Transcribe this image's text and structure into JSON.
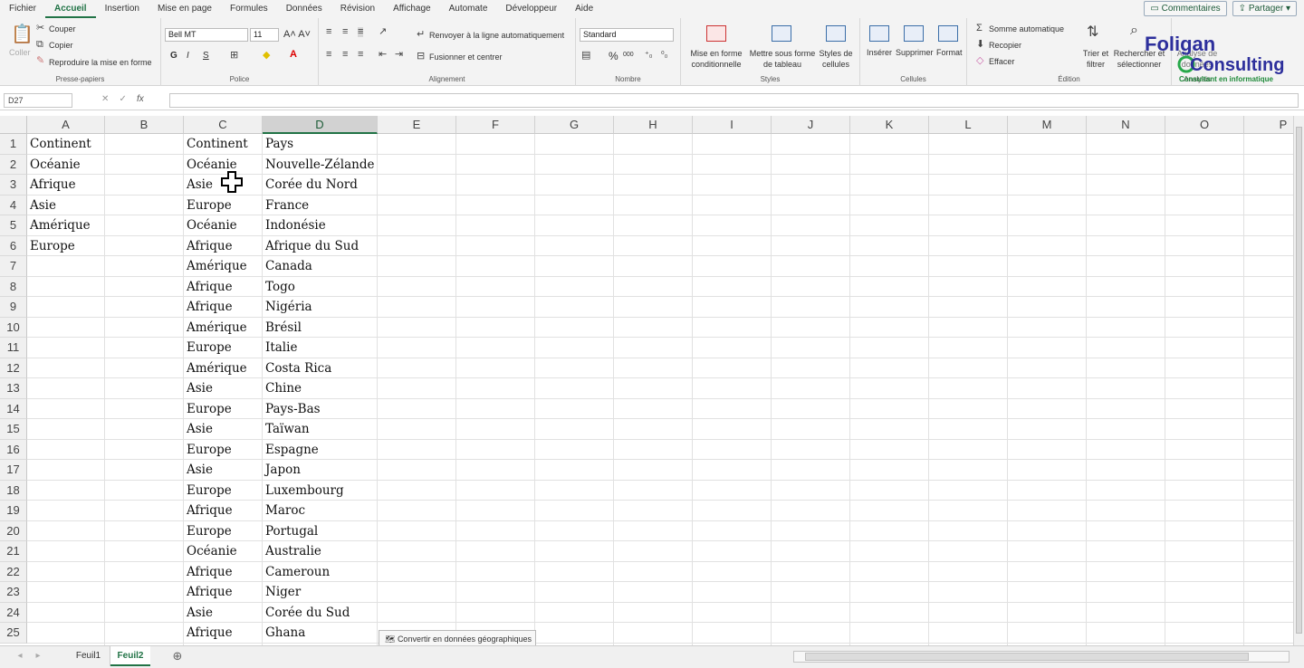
{
  "menu": {
    "tabs": [
      "Fichier",
      "Accueil",
      "Insertion",
      "Mise en page",
      "Formules",
      "Données",
      "Révision",
      "Affichage",
      "Automate",
      "Développeur",
      "Aide"
    ],
    "active": "Accueil",
    "comments_label": "Commentaires",
    "share_label": "Partager"
  },
  "ribbon": {
    "clipboard": {
      "paste": "Coller",
      "cut": "Couper",
      "copy": "Copier",
      "format_painter": "Reproduire la mise en forme",
      "title": "Presse-papiers"
    },
    "font": {
      "name": "Bell MT",
      "size": "11",
      "bold": "G",
      "italic": "I",
      "underline": "S",
      "title": "Police"
    },
    "alignment": {
      "wrap": "Renvoyer à la ligne automatiquement",
      "merge": "Fusionner et centrer",
      "title": "Alignement"
    },
    "number": {
      "format": "Standard",
      "percent": "%",
      "thousands": "000",
      "title": "Nombre"
    },
    "styles": {
      "conditional": "Mise en forme conditionnelle",
      "table": "Mettre sous forme de tableau",
      "cell_styles": "Styles de cellules",
      "title": "Styles"
    },
    "cells": {
      "insert": "Insérer",
      "delete": "Supprimer",
      "format": "Format",
      "title": "Cellules"
    },
    "editing": {
      "autosum": "Somme automatique",
      "fill": "Recopier",
      "clear": "Effacer",
      "sort": "Trier et filtrer",
      "find": "Rechercher et sélectionner",
      "title": "Édition"
    },
    "analysis": {
      "analyze": "Analyse de données",
      "title": "Analysis"
    }
  },
  "logo": {
    "line1": "Foligan",
    "line2": "Consulting",
    "tagline": "Consultant en informatique"
  },
  "formula_bar": {
    "name_box": "D27",
    "fx": "fx",
    "value": ""
  },
  "columns": [
    "A",
    "B",
    "C",
    "D",
    "E",
    "F",
    "G",
    "H",
    "I",
    "J",
    "K",
    "L",
    "M",
    "N",
    "O",
    "P"
  ],
  "selected_column": "D",
  "rows": [
    "1",
    "2",
    "3",
    "4",
    "5",
    "6",
    "7",
    "8",
    "9",
    "10",
    "11",
    "12",
    "13",
    "14",
    "15",
    "16",
    "17",
    "18",
    "19",
    "20",
    "21",
    "22",
    "23",
    "24",
    "25"
  ],
  "col_a": [
    "Continent",
    "Océanie",
    "Afrique",
    "Asie",
    "Amérique",
    "Europe"
  ],
  "col_c": [
    "Continent",
    "Océanie",
    "Asie",
    "Europe",
    "Océanie",
    "Afrique",
    "Amérique",
    "Afrique",
    "Afrique",
    "Amérique",
    "Europe",
    "Amérique",
    "Asie",
    "Europe",
    "Asie",
    "Europe",
    "Asie",
    "Europe",
    "Afrique",
    "Europe",
    "Océanie",
    "Afrique",
    "Afrique",
    "Asie",
    "Afrique"
  ],
  "col_d": [
    "Pays",
    "Nouvelle-Zélande",
    "Corée du Nord",
    "France",
    "Indonésie",
    "Afrique du Sud",
    "Canada",
    "Togo",
    "Nigéria",
    "Brésil",
    "Italie",
    "Costa Rica",
    "Chine",
    "Pays-Bas",
    "Taïwan",
    "Espagne",
    "Japon",
    "Luxembourg",
    "Maroc",
    "Portugal",
    "Australie",
    "Cameroun",
    "Niger",
    "Corée du Sud",
    "Ghana"
  ],
  "sheets": [
    "Feuil1",
    "Feuil2"
  ],
  "active_sheet": "Feuil2",
  "geo_button": "Convertir en données géographiques"
}
